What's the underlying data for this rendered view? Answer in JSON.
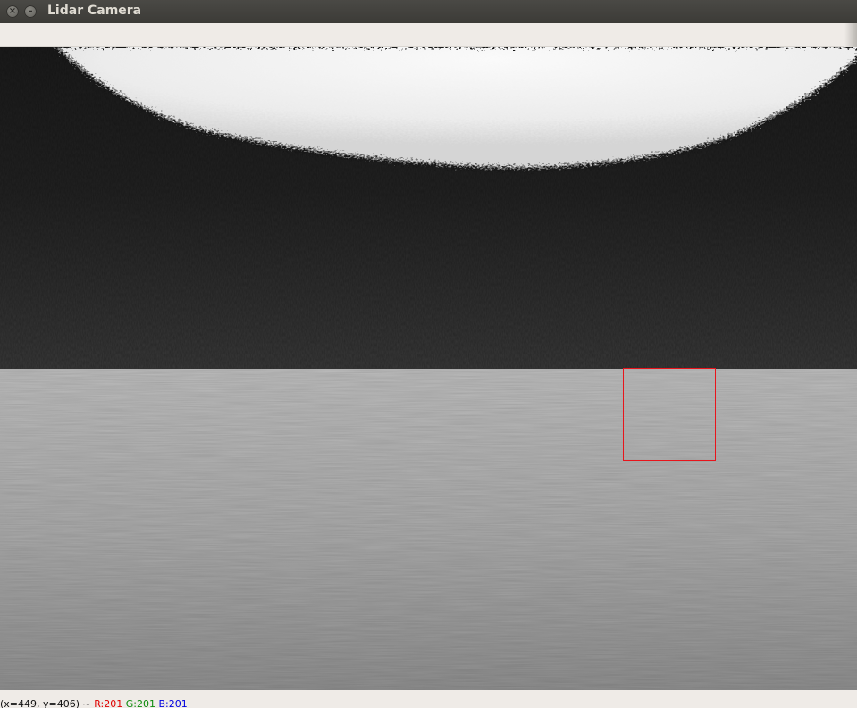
{
  "window": {
    "title": "Lidar Camera",
    "close_glyph": "×",
    "minimize_glyph": "–"
  },
  "status": {
    "coords": "(x=449, y=406) ~ ",
    "r": "R:201",
    "g": "G:201",
    "b": "B:201",
    "r_color": "#e00000",
    "g_color": "#0a8a0a",
    "b_color": "#0000e0"
  },
  "roi": {
    "color": "#e8141b"
  }
}
